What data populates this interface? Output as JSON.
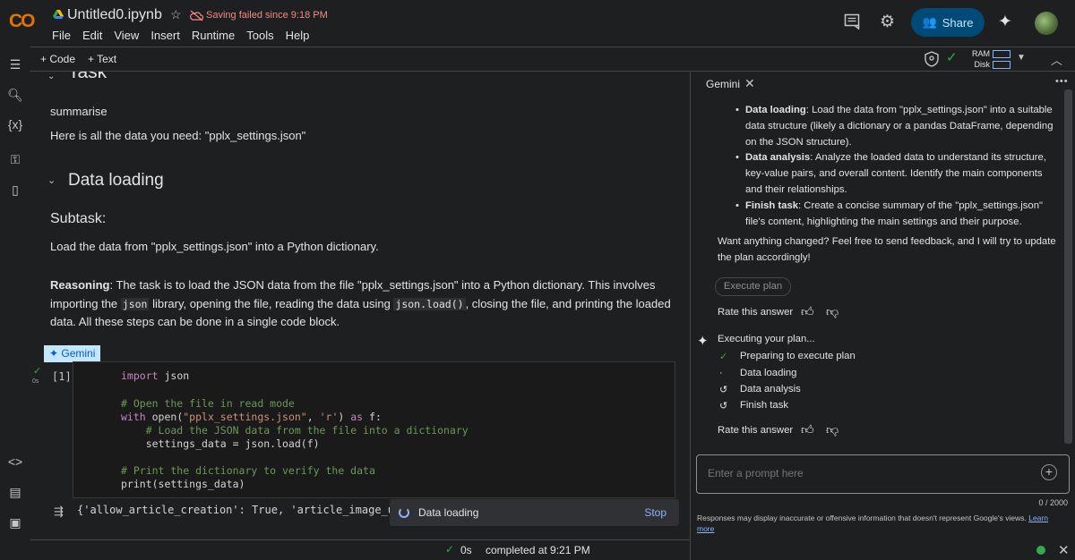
{
  "header": {
    "logo": "CO",
    "notebook_title": "Untitled0.ipynb",
    "save_status": "Saving failed since 9:18 PM",
    "menu": [
      "File",
      "Edit",
      "View",
      "Insert",
      "Runtime",
      "Tools",
      "Help"
    ],
    "share_label": "Share"
  },
  "toolbar": {
    "add_code": "+ Code",
    "add_text": "+ Text",
    "ram_label": "RAM",
    "disk_label": "Disk"
  },
  "notebook": {
    "task_heading": "Task",
    "summarise": "summarise",
    "data_line": "Here is all the data you need: \"pplx_settings.json\"",
    "data_loading_heading": "Data loading",
    "subtask_heading": "Subtask:",
    "subtask_text": "Load the data from \"pplx_settings.json\" into a Python dictionary.",
    "reasoning_label": "Reasoning",
    "reasoning_part1": ": The task is to load the JSON data from the file \"pplx_settings.json\" into a Python dictionary. This involves importing the ",
    "reasoning_code1": "json",
    "reasoning_part2": " library, opening the file, reading the data using ",
    "reasoning_code2": "json.load()",
    "reasoning_part3": ", closing the file, and printing the loaded data. All these steps can be done in a single code block.",
    "gemini_chip": "✦ Gemini",
    "cell_number": "[1]",
    "cell_time": "0s",
    "code_lines": {
      "l1_kw": "import",
      "l1_rest": " json",
      "l2": "# Open the file in read mode",
      "l3_kw": "with",
      "l3_a": " open(",
      "l3_s1": "\"pplx_settings.json\"",
      "l3_b": ", ",
      "l3_s2": "'r'",
      "l3_c": ") ",
      "l3_kw2": "as",
      "l3_d": " f:",
      "l4": "    # Load the JSON data from the file into a dictionary",
      "l5": "    settings_data = json.load(f)",
      "l6": "# Print the dictionary to verify the data",
      "l7": "print(settings_data)"
    },
    "output_text": "{'allow_article_creation': True, 'article_image_uplo",
    "toast_text": "Data loading",
    "toast_stop": "Stop"
  },
  "statusbar": {
    "elapsed": "0s",
    "completed": "completed at 9:21 PM"
  },
  "gemini_panel": {
    "title": "Gemini",
    "plan_items": [
      {
        "bold": "Data loading",
        "text": ": Load the data from \"pplx_settings.json\" into a suitable data structure (likely a dictionary or a pandas DataFrame, depending on the JSON structure)."
      },
      {
        "bold": "Data analysis",
        "text": ": Analyze the loaded data to understand its structure, key-value pairs, and overall content. Identify the main components and their relationships."
      },
      {
        "bold": "Finish task",
        "text": ": Create a concise summary of the \"pplx_settings.json\" file's content, highlighting the main settings and their purpose."
      }
    ],
    "feedback_text": "Want anything changed? Feel free to send feedback, and I will try to update the plan accordingly!",
    "execute_plan": "Execute plan",
    "rate_label": "Rate this answer",
    "executing_label": "Executing your plan...",
    "steps": [
      {
        "icon": "✓",
        "label": "Preparing to execute plan"
      },
      {
        "icon": "·",
        "label": "Data loading"
      },
      {
        "icon": "↺",
        "label": "Data analysis"
      },
      {
        "icon": "↺",
        "label": "Finish task"
      }
    ],
    "prompt_placeholder": "Enter a prompt here",
    "char_count": "0 / 2000",
    "disclaimer": "Responses may display inaccurate or offensive information that doesn't represent Google's views.",
    "learn_more": "Learn more"
  }
}
